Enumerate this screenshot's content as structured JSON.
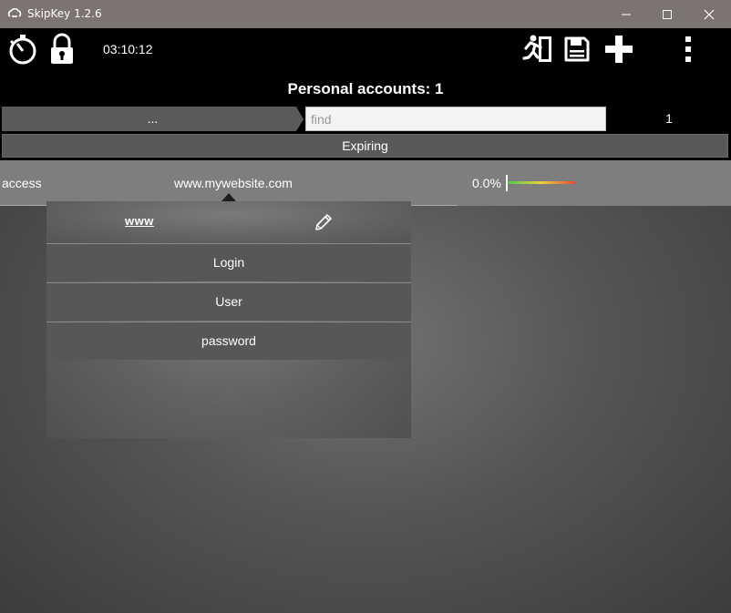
{
  "window": {
    "title": "SkipKey 1.2.6",
    "icons": [
      "app-logo-icon",
      "minimize-icon",
      "maximize-icon",
      "close-icon"
    ]
  },
  "toolbar": {
    "clock": "03:10:12",
    "icons": [
      "timer-icon",
      "lock-icon",
      "exit-icon",
      "save-icon",
      "add-icon",
      "more-vert-icon"
    ]
  },
  "accounts": {
    "title": "Personal accounts: 1"
  },
  "filter": {
    "dots_label": "...",
    "find_placeholder": "find",
    "find_value": "",
    "count": "1"
  },
  "expiring": {
    "label": "Expiring"
  },
  "entry": {
    "access": "access",
    "site": "www.mywebsite.com",
    "strength_percent": "0.0%",
    "strength_value": 0.0
  },
  "popup": {
    "www_label": "www",
    "items": [
      {
        "label": "Login"
      },
      {
        "label": "User"
      },
      {
        "label": "password"
      }
    ]
  },
  "colors": {
    "titlebar": "#7c7472",
    "toolbar": "#000000",
    "strength_low": "#54c84a",
    "strength_mid": "#e8d23c",
    "strength_high": "#e64a3a"
  }
}
